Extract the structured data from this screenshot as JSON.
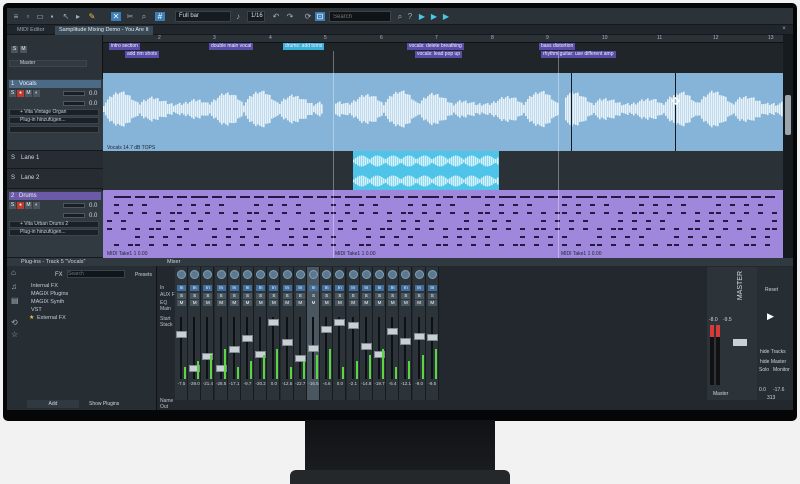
{
  "toolbar": {
    "snap_value": "Full bar",
    "grid_value": "1/16",
    "search_placeholder": "Search"
  },
  "tabs": [
    {
      "label": "MIDI Editor"
    },
    {
      "label": "Samplitude Mixing Demo - You Are It"
    }
  ],
  "ruler": {
    "numbers": [
      "2",
      "3",
      "4",
      "5",
      "6",
      "7",
      "8",
      "9",
      "10",
      "11",
      "12",
      "13"
    ]
  },
  "master_label": "Master",
  "tracks": [
    {
      "number": "1",
      "name": "Vocals",
      "values": [
        "0.0",
        "0.0"
      ],
      "plugin_slot": "+ Vita Vintage Organ",
      "add_plugin": "Plug-in hinzufügen...",
      "lanes": [
        {
          "label": "Lane 1"
        },
        {
          "label": "Lane 2"
        }
      ]
    },
    {
      "number": "2",
      "name": "Drums",
      "values": [
        "0.0",
        "0.0"
      ],
      "plugin_slot": "+ Vita Urban Drums 2",
      "add_plugin": "Plug-in hinzufügen..."
    }
  ],
  "markers": [
    {
      "label": "intro section"
    },
    {
      "label": "add rim shots"
    },
    {
      "label": "double main vocal"
    },
    {
      "label": "drums: add toms"
    },
    {
      "label": "vocals: delete breathing"
    },
    {
      "label": "vocals: lead pop up"
    },
    {
      "label": "bass distortion"
    },
    {
      "label": "rhythm guitar: use different amp"
    }
  ],
  "clip_labels": {
    "vocals": "Vocals   14.7 dB   TOPS",
    "drums_1": "MIDI Take1  1  0.00",
    "drums_2": "MIDI Take1  1  0.00",
    "drums_3": "MIDI Take1  1  0.00"
  },
  "browser": {
    "title": "Plug-ins - Track 5 \"Vocals\"",
    "fx_label": "FX",
    "search_placeholder": "Search",
    "presets_label": "Presets",
    "items": [
      {
        "label": "Internal FX"
      },
      {
        "label": "MAGIX Plugins"
      },
      {
        "label": "MAGIX Synth"
      },
      {
        "label": "VST"
      },
      {
        "label": "External FX"
      }
    ],
    "add_label": "Add",
    "show_plugins_label": "Show Plugins"
  },
  "mixer": {
    "title": "Mixer",
    "row_labels": {
      "in": "In",
      "aux": "AUX FX",
      "eq": "EQ",
      "main": "Main",
      "start_stack": "Start Stack",
      "name": "Name",
      "out": "Out"
    },
    "volumes": [
      "-7.5",
      "-29.0",
      "-21.4",
      "-28.5",
      "-17.1",
      "-9.7",
      "-20.2",
      "0.0",
      "-12.5",
      "-22.7",
      "-16.5",
      "-4.6",
      "0.0",
      "-2.1",
      "-14.8",
      "-19.7",
      "-5.4",
      "-12.1",
      "-9.0",
      "-9.5"
    ],
    "master_label": "MASTER",
    "master_name": "Master",
    "master_out": "Master",
    "master_values": [
      "-8.0",
      "-9.5"
    ],
    "side_labels": {
      "reset": "Reset",
      "hide_tracks": "hide Tracks",
      "hide_master": "hide Master",
      "solo": "Solo",
      "monitor": "Monitor",
      "solo_value": "0.0",
      "monitor_value": "-17.6",
      "bottom_value": "313"
    }
  }
}
